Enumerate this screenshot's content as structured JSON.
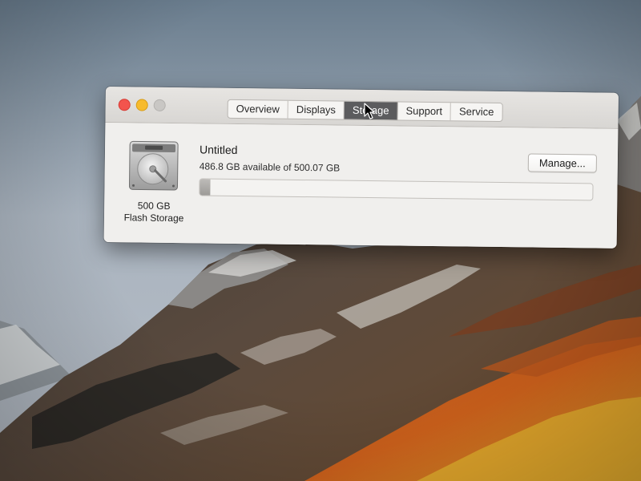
{
  "window": {
    "tabs": [
      {
        "label": "Overview",
        "active": false
      },
      {
        "label": "Displays",
        "active": false
      },
      {
        "label": "Storage",
        "active": true
      },
      {
        "label": "Support",
        "active": false
      },
      {
        "label": "Service",
        "active": false
      }
    ]
  },
  "storage": {
    "disk_icon": "hard-drive-icon",
    "disk_capacity": "500 GB",
    "disk_type": "Flash Storage",
    "volume_name": "Untitled",
    "volume_available": "486.8 GB available of 500.07 GB",
    "used_fraction": 0.027,
    "manage_label": "Manage..."
  },
  "colors": {
    "close": "#f3544d",
    "minimize": "#f7bb2d",
    "zoom": "#c9c7c4",
    "active_tab": "#5c5c5e"
  }
}
